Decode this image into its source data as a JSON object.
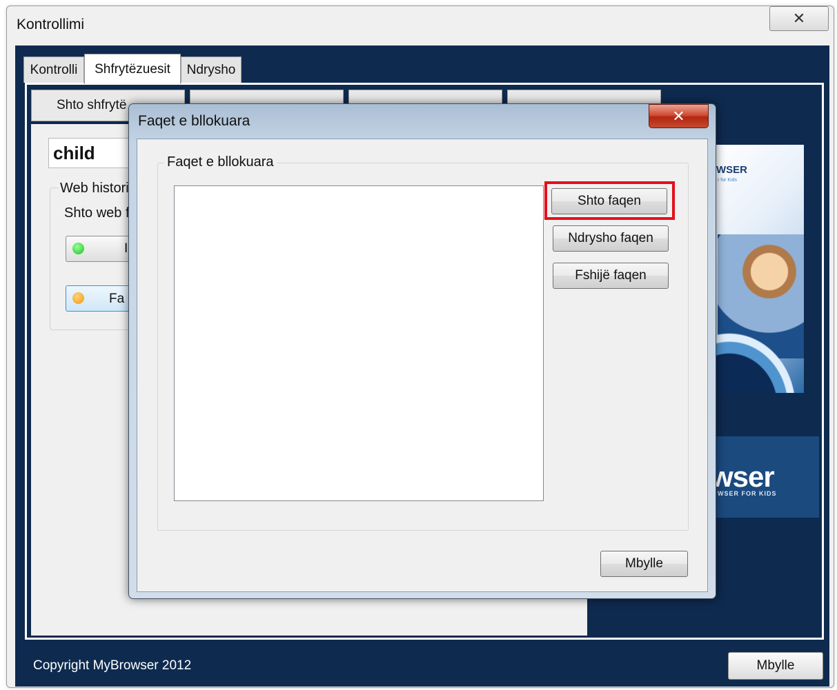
{
  "main_window": {
    "title": "Kontrollimi",
    "close_glyph": "✕",
    "tabs": [
      {
        "label": "Kontrolli"
      },
      {
        "label": "Shfrytëzuesit"
      },
      {
        "label": "Ndrysho"
      }
    ],
    "sub_tabs": [
      {
        "label": "Shto shfrytë"
      }
    ],
    "user_name": "child",
    "web_history_label": "Web histori",
    "add_web_label": "Shto web f",
    "status_buttons": [
      {
        "dot_color": "#13c313",
        "label": "I"
      },
      {
        "dot_color": "#f29a10",
        "label": "Fa"
      }
    ],
    "product": {
      "box_title": "WSER",
      "box_sub": "r for Kids",
      "brand": "wser",
      "brand_sub": "WSER FOR KIDS"
    },
    "copyright": "Copyright MyBrowser 2012",
    "close_button": "Mbylle"
  },
  "dialog": {
    "title": "Faqet e bllokuara",
    "close_glyph": "✕",
    "group_label": "Faqet e bllokuara",
    "buttons": {
      "add": "Shto faqen",
      "edit": "Ndrysho faqen",
      "delete": "Fshijë faqen",
      "close": "Mbylle"
    },
    "highlight_color": "#e3101c"
  }
}
